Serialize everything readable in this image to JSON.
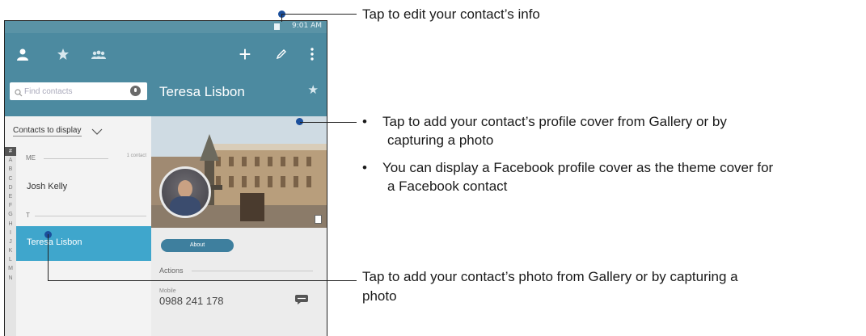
{
  "status_bar": {
    "time": "9:01 AM"
  },
  "app_bar": {
    "icons": [
      "person-icon",
      "star-icon",
      "group-icon",
      "plus-icon",
      "edit-icon",
      "more-icon"
    ]
  },
  "search": {
    "placeholder": "Find contacts"
  },
  "contact_header": {
    "name": "Teresa Lisbon"
  },
  "contacts_list": {
    "filter_label": "Contacts to display",
    "alphabet": [
      "#",
      "A",
      "B",
      "C",
      "D",
      "E",
      "F",
      "G",
      "H",
      "I",
      "J",
      "K",
      "L",
      "M",
      "N"
    ],
    "sections": [
      {
        "letter": "ME",
        "count": "1 contact",
        "names": [
          "Josh Kelly"
        ]
      },
      {
        "letter": "T",
        "count": "",
        "names": [
          "Teresa Lisbon"
        ]
      }
    ],
    "selected": "Teresa Lisbon"
  },
  "detail": {
    "about_label": "About",
    "actions_label": "Actions",
    "mobile_label": "Mobile",
    "phone": "0988 241 178"
  },
  "annotations": {
    "edit": "Tap to edit your contact’s info",
    "cover_bullet1": "Tap to add your contact’s profile cover from Gallery or by",
    "cover_bullet1_cont": "capturing a photo",
    "cover_bullet2": "You can display a Facebook profile cover as the theme cover for",
    "cover_bullet2_cont": "a Facebook contact",
    "photo": "Tap to add your contact’s photo from Gallery or by capturing a",
    "photo_cont": "photo"
  },
  "colors": {
    "app_bar": "#4c8aa0",
    "selected_row": "#3fa6cc",
    "callout_dot": "#1b4f9c"
  }
}
